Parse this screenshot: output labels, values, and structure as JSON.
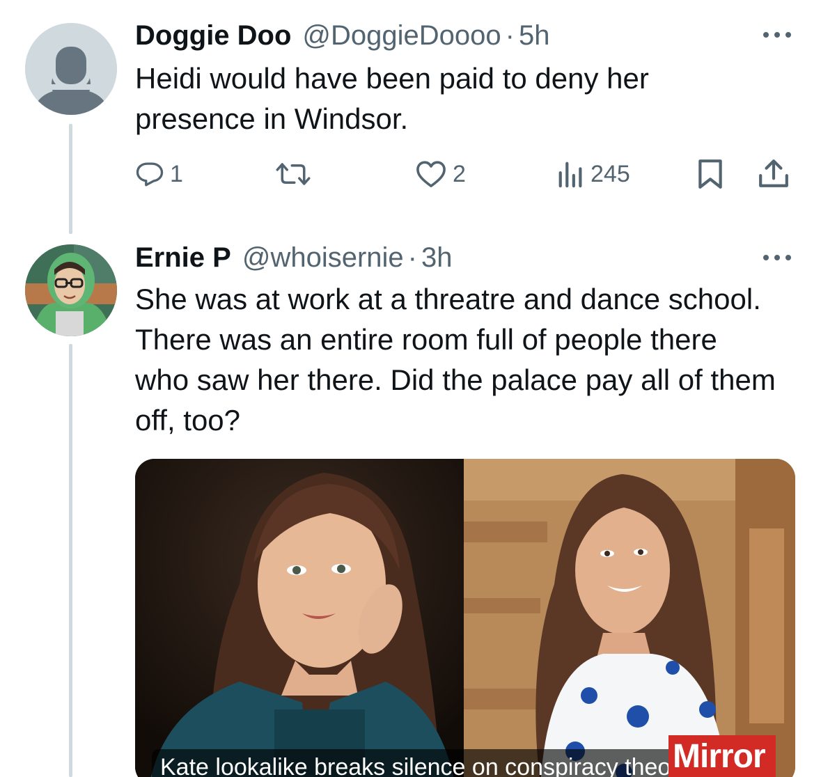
{
  "tweets": [
    {
      "display_name": "Doggie Doo",
      "handle": "@DoggieDoooo",
      "separator": "·",
      "time": "5h",
      "text": "Heidi would have been paid to deny her presence in Windsor.",
      "replies": "1",
      "likes": "2",
      "views": "245",
      "avatar_icon": "default-avatar-icon"
    },
    {
      "display_name": "Ernie P",
      "handle": "@whoisernie",
      "separator": "·",
      "time": "3h",
      "text": "She was at work at a threatre and dance school. There was an entire room full of people there who saw her there. Did the palace pay all of them off, too?",
      "avatar_icon": "profile-photo",
      "media": {
        "caption": "Kate lookalike breaks silence on conspiracy theo...",
        "badge": "Mirror"
      }
    }
  ],
  "icons": {
    "reply": "reply-icon",
    "retweet": "retweet-icon",
    "like": "heart-icon",
    "views": "views-chart-icon",
    "bookmark": "bookmark-icon",
    "share": "share-icon",
    "more": "more-icon"
  },
  "colors": {
    "text": "#0f1419",
    "secondary": "#536471",
    "thread_line": "#cfd9de",
    "mirror_red": "#d22a24"
  }
}
